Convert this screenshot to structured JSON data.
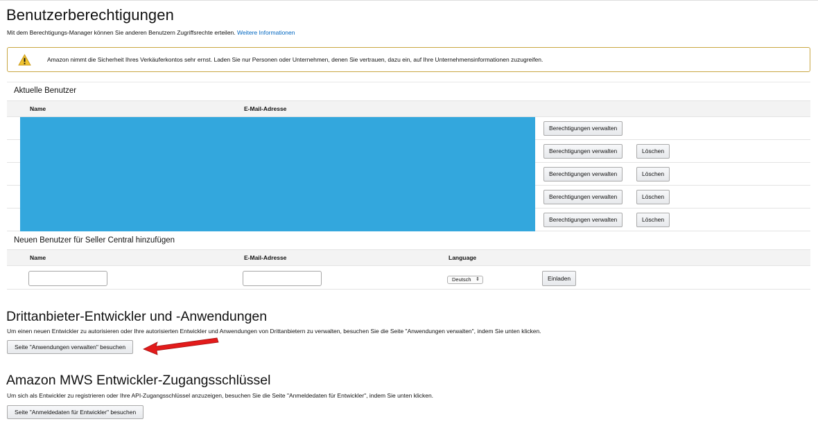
{
  "page": {
    "title": "Benutzerberechtigungen",
    "intro": "Mit dem Berechtigungs-Manager können Sie anderen Benutzern Zugriffsrechte erteilen.",
    "more_link": "Weitere Informationen"
  },
  "alert": {
    "icon": "warning-icon",
    "message": "Amazon nimmt die Sicherheit Ihres Verkäuferkontos sehr ernst. Laden Sie nur Personen oder Unternehmen, denen Sie vertrauen, dazu ein, auf Ihre Unternehmensinformationen zuzugreifen."
  },
  "current_users": {
    "heading": "Aktuelle Benutzer",
    "columns": {
      "name": "Name",
      "email": "E-Mail-Adresse"
    },
    "rows": [
      {
        "manage": "Berechtigungen verwalten",
        "delete": ""
      },
      {
        "manage": "Berechtigungen verwalten",
        "delete": "Löschen"
      },
      {
        "manage": "Berechtigungen verwalten",
        "delete": "Löschen"
      },
      {
        "manage": "Berechtigungen verwalten",
        "delete": "Löschen"
      },
      {
        "manage": "Berechtigungen verwalten",
        "delete": "Löschen"
      }
    ],
    "redaction_color": "#33a7dd"
  },
  "add_user": {
    "heading": "Neuen Benutzer für Seller Central hinzufügen",
    "columns": {
      "name": "Name",
      "email": "E-Mail-Adresse",
      "language": "Language"
    },
    "name_value": "",
    "email_value": "",
    "language_selected": "Deutsch",
    "invite_button": "Einladen"
  },
  "third_party": {
    "heading": "Drittanbieter-Entwickler und -Anwendungen",
    "description": "Um einen neuen Entwickler zu autorisieren oder Ihre autorisierten Entwickler und Anwendungen von Drittanbietern zu verwalten, besuchen Sie die Seite \"Anwendungen verwalten\", indem Sie unten klicken.",
    "button": "Seite \"Anwendungen verwalten\" besuchen",
    "annotation_color": "#e31b1b"
  },
  "mws": {
    "heading": "Amazon MWS Entwickler-Zugangsschlüssel",
    "description": "Um sich als Entwickler zu registrieren oder Ihre API-Zugangsschlüssel anzuzeigen, besuchen Sie die Seite \"Anmeldedaten für Entwickler\", indem Sie unten klicken.",
    "button": "Seite \"Anmeldedaten für Entwickler\" besuchen"
  },
  "colors": {
    "link": "#0066c0",
    "alert_border": "#c8a640",
    "header_bg": "#f3f3f3"
  }
}
